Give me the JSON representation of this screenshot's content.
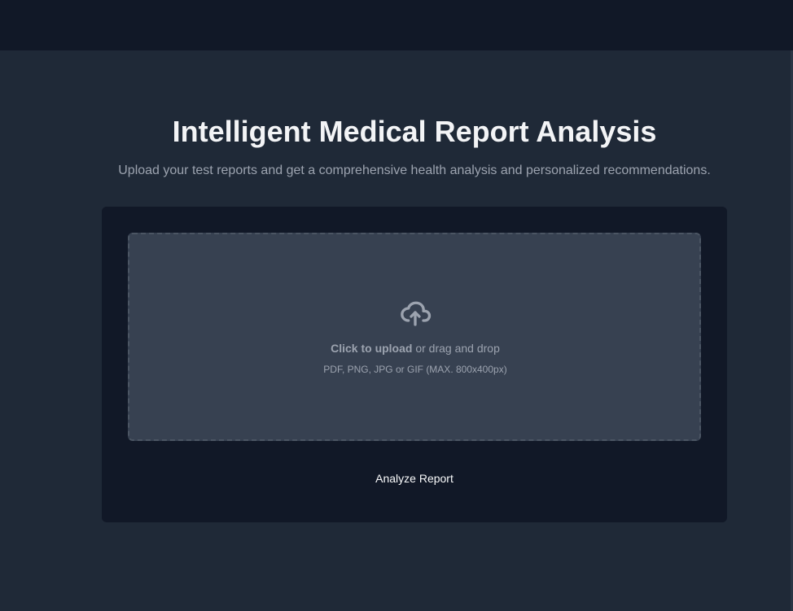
{
  "hero": {
    "title": "Intelligent Medical Report Analysis",
    "subtitle": "Upload your test reports and get a comprehensive health analysis and personalized recommendations."
  },
  "upload": {
    "icon": "cloud-upload-icon",
    "click_label": "Click to upload",
    "drag_label": "or drag and drop",
    "hint": "PDF, PNG, JPG or GIF (MAX. 800x400px)"
  },
  "actions": {
    "analyze_label": "Analyze Report"
  },
  "colors": {
    "background": "#1f2937",
    "header": "#111827",
    "card": "#111827",
    "dropzone": "#374151",
    "muted_text": "#9ca3af",
    "title_text": "#f3f4f6"
  }
}
